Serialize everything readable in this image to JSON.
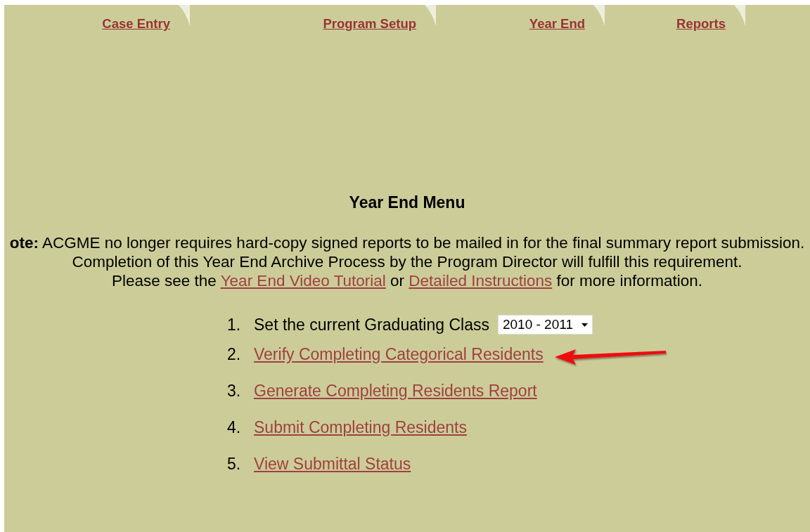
{
  "tabs": [
    {
      "label": "Case Entry"
    },
    {
      "label": "Program Setup"
    },
    {
      "label": "Year End"
    },
    {
      "label": "Reports"
    }
  ],
  "title": "Year End Menu",
  "note": {
    "line_1": "**ote:** ACGME no longer requires hard-copy signed reports to be mailed in for the final summary report submission.",
    "line_2": "Completion of this Year End Archive Process by the Program Director will fulfill this requirement.",
    "line_3": {
      "before": "Please see the",
      "link_1": "Year End Video Tutorial",
      "middle": "or",
      "link_2": "Detailed Instructions",
      "after": "for more information."
    }
  },
  "steps": [
    {
      "number": "1.",
      "kind": "select",
      "label": "Set the current Graduating Class",
      "value": "2010 - 2011"
    },
    {
      "number": "2.",
      "kind": "link",
      "label": "Verify Completing Categorical Residents",
      "pointer": true
    },
    {
      "number": "3.",
      "kind": "link",
      "label": "Generate Completing Residents Report",
      "pointer": false
    },
    {
      "number": "4.",
      "kind": "link",
      "label": "Submit Completing Residents",
      "pointer": false
    },
    {
      "number": "5.",
      "kind": "link",
      "label": "View Submittal Status",
      "pointer": false
    }
  ]
}
